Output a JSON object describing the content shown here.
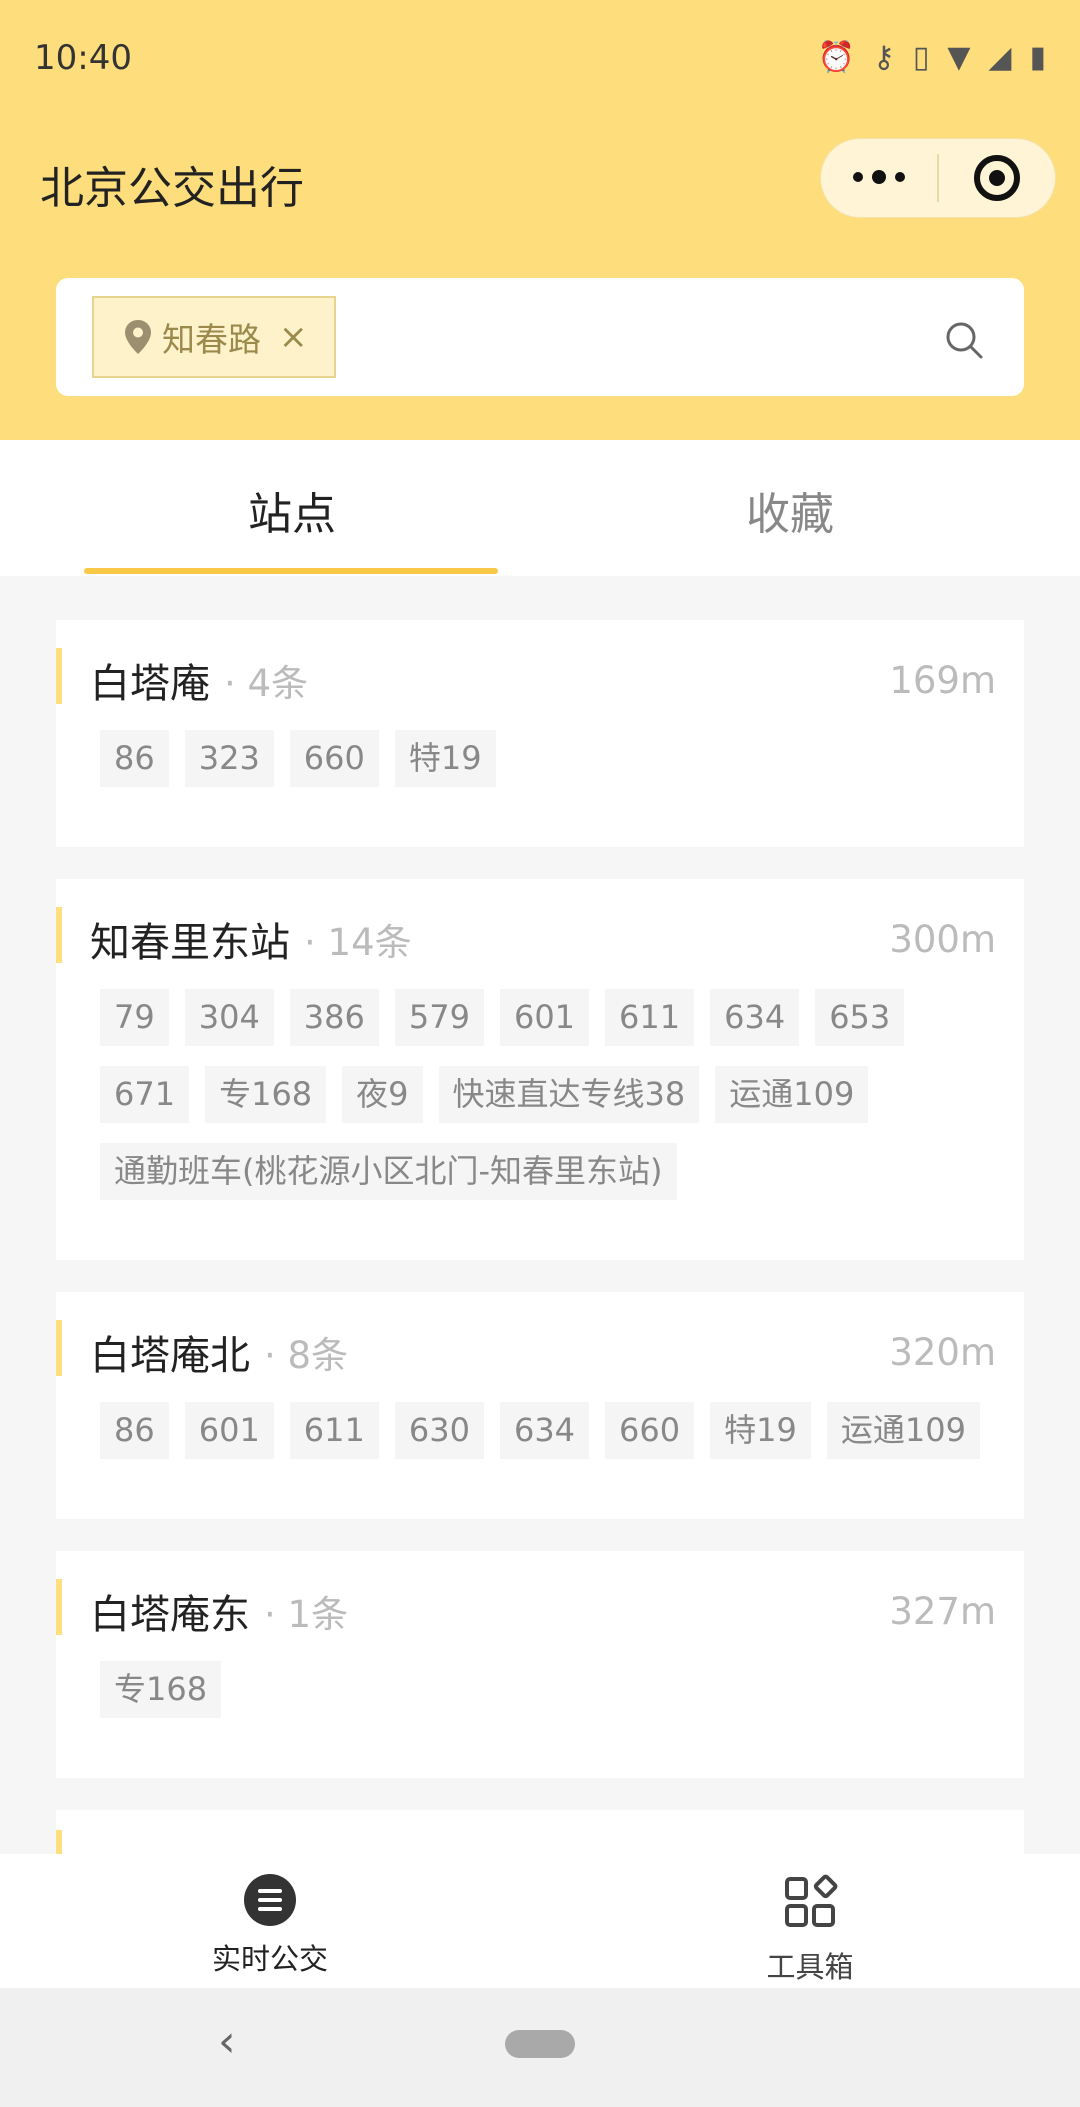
{
  "status_bar": {
    "time": "10:40"
  },
  "app": {
    "title": "北京公交出行"
  },
  "search": {
    "tag_label": "知春路",
    "remove_glyph": "×"
  },
  "tabs": [
    {
      "label": "站点",
      "active": true
    },
    {
      "label": "收藏",
      "active": false
    }
  ],
  "stations": [
    {
      "name": "白塔庵",
      "count": "· 4条",
      "distance": "169m",
      "routes": [
        "86",
        "323",
        "660",
        "特19"
      ]
    },
    {
      "name": "知春里东站",
      "count": "· 14条",
      "distance": "300m",
      "routes": [
        "79",
        "304",
        "386",
        "579",
        "601",
        "611",
        "634",
        "653",
        "671",
        "专168",
        "夜9",
        "快速直达专线38",
        "运通109",
        "通勤班车(桃花源小区北门-知春里东站)"
      ]
    },
    {
      "name": "白塔庵北",
      "count": "· 8条",
      "distance": "320m",
      "routes": [
        "86",
        "601",
        "611",
        "630",
        "634",
        "660",
        "特19",
        "运通109"
      ]
    },
    {
      "name": "白塔庵东",
      "count": "· 1条",
      "distance": "327m",
      "routes": [
        "专168"
      ]
    }
  ],
  "bottom_nav": [
    {
      "label": "实时公交",
      "icon": "list-circle-icon",
      "active": true
    },
    {
      "label": "工具箱",
      "icon": "grid-tools-icon",
      "active": false
    }
  ],
  "system_nav": {
    "back_glyph": "‹"
  },
  "colors": {
    "header_bg": "#fede7c",
    "accent": "#f8c846",
    "tag_bg": "#fdf2c9"
  }
}
